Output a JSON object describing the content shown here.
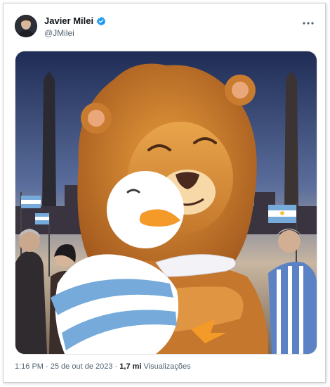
{
  "tweet": {
    "author_name": "Javier Milei",
    "author_handle": "@JMilei",
    "more_icon": "more-horizontal-icon",
    "verified_icon": "verified-badge-icon",
    "time": "1:16 PM",
    "separator": "·",
    "date": "25 de out de 2023",
    "views_count": "1,7 mi",
    "views_label": "Visualizações"
  },
  "colors": {
    "verified_blue": "#1d9bf0",
    "text_primary": "#0f1419",
    "text_secondary": "#536471",
    "argentina_blue": "#75aadb"
  }
}
